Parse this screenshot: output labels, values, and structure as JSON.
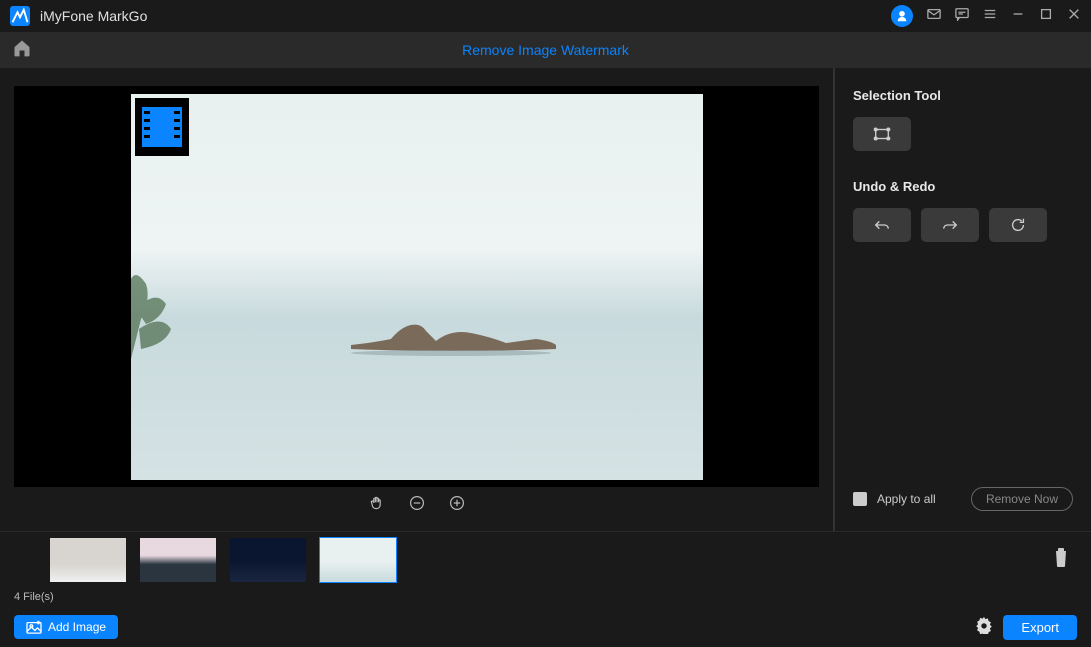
{
  "app": {
    "title": "iMyFone MarkGo"
  },
  "tab": {
    "title": "Remove Image Watermark"
  },
  "sidebar": {
    "selectionTitle": "Selection Tool",
    "undoRedoTitle": "Undo & Redo",
    "applyAllLabel": "Apply to all",
    "removeNowLabel": "Remove Now"
  },
  "footer": {
    "fileCount": "4 File(s)",
    "addImageLabel": "Add Image",
    "exportLabel": "Export"
  },
  "thumbnails": {
    "count": 4,
    "selectedIndex": 3
  }
}
